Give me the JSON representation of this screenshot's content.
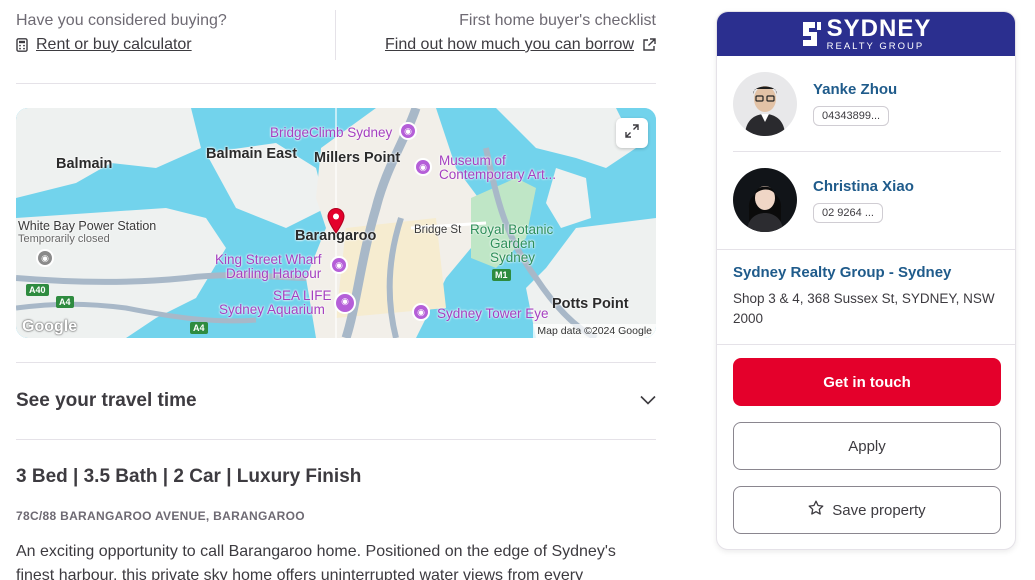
{
  "top": {
    "buying_prompt": "Have you considered buying?",
    "calculator_link": "Rent or buy calculator",
    "checklist_prompt": "First home buyer's checklist",
    "borrow_link": "Find out how much you can borrow"
  },
  "map": {
    "labels": {
      "balmain": "Balmain",
      "balmain_east": "Balmain East",
      "millers_point": "Millers Point",
      "bridgeclimb": "BridgeClimb Sydney",
      "museum_1": "Museum of",
      "museum_2": "Contemporary Art...",
      "white_bay_1": "White Bay Power Station",
      "white_bay_2": "Temporarily closed",
      "barangaroo": "Barangaroo",
      "bridge_st": "Bridge St",
      "botanic_1": "Royal Botanic",
      "botanic_2": "Garden",
      "botanic_3": "Sydney",
      "king_street_1": "King Street Wharf",
      "king_street_2": "Darling Harbour",
      "sea_life_1": "SEA LIFE",
      "sea_life_2": "Sydney Aquarium",
      "tower_eye": "Sydney Tower Eye",
      "potts_point": "Potts Point",
      "a40": "A40",
      "a4": "A4",
      "a4b": "A4",
      "m1": "M1"
    },
    "google": "Google",
    "attribution": "Map data ©2024 Google"
  },
  "travel": {
    "title": "See your travel time"
  },
  "listing": {
    "headline": "3 Bed | 3.5 Bath | 2 Car | Luxury Finish",
    "address": "78C/88 BARANGAROO AVENUE, BARANGAROO",
    "description": "An exciting opportunity to call Barangaroo home. Positioned on the edge of Sydney's finest harbour, this private sky home offers uninterrupted water views from every"
  },
  "agency_card": {
    "brand_color": "#2b2f8f",
    "logo_main": "SYDNEY",
    "logo_sub": "REALTY GROUP",
    "agents": [
      {
        "name": "Yanke Zhou",
        "phone": "04343899..."
      },
      {
        "name": "Christina Xiao",
        "phone": "02 9264 ..."
      }
    ],
    "agency_name": "Sydney Realty Group - Sydney",
    "agency_address": "Shop 3 & 4, 368 Sussex St, SYDNEY, NSW 2000",
    "get_in_touch": "Get in touch",
    "apply": "Apply",
    "save": "Save property"
  },
  "colors": {
    "accent_red": "#e4002b",
    "link_blue": "#1f5b8b"
  }
}
